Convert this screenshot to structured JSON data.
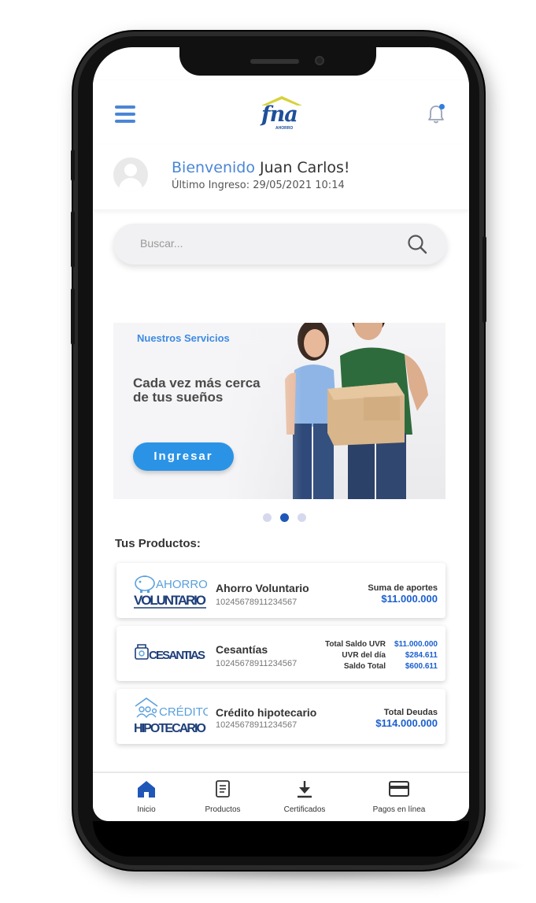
{
  "app": {
    "logo_text": "fna",
    "logo_sub": "AHORRO"
  },
  "welcome": {
    "greeting": "Bienvenido",
    "user_name": "Juan Carlos!",
    "last_login": "Último Ingreso: 29/05/2021 10:14"
  },
  "search": {
    "placeholder": "Buscar..."
  },
  "banner": {
    "section_label": "Nuestros Servicios",
    "tagline": "Cada vez más cerca de tus sueños",
    "cta_label": "Ingresar",
    "slides_total": 3,
    "active_slide": 2
  },
  "products": {
    "title": "Tus Productos:",
    "items": [
      {
        "logo_top": "AHORRO",
        "logo_bottom": "VOLUNTARIO",
        "name": "Ahorro Voluntario",
        "number": "10245678911234567",
        "amount_label": "Suma de aportes",
        "amount_value": "$11.000.000"
      },
      {
        "logo_text": "CESANTIAS",
        "name": "Cesantías",
        "number": "10245678911234567",
        "rows": [
          {
            "label": "Total Saldo UVR",
            "value": "$11.000.000"
          },
          {
            "label": "UVR del día",
            "value": "$284.611"
          },
          {
            "label": "Saldo Total",
            "value": "$600.611"
          }
        ]
      },
      {
        "logo_top": "CRÉDITO",
        "logo_bottom": "HIPOTECARIO",
        "name": "Crédito hipotecario",
        "number": "10245678911234567",
        "amount_label": "Total Deudas",
        "amount_value": "$114.000.000"
      }
    ]
  },
  "tabbar": {
    "tabs": [
      {
        "label": "Inicio",
        "icon": "home-icon",
        "active": true
      },
      {
        "label": "Productos",
        "icon": "document-icon"
      },
      {
        "label": "Certificados",
        "icon": "download-icon"
      },
      {
        "label": "Pagos en línea",
        "icon": "credit-card-icon"
      }
    ]
  },
  "colors": {
    "brand_blue": "#1e4f9a",
    "accent_blue": "#2a93e6",
    "amount_blue": "#1a5fd1",
    "logo_yellow": "#d6d23a"
  }
}
